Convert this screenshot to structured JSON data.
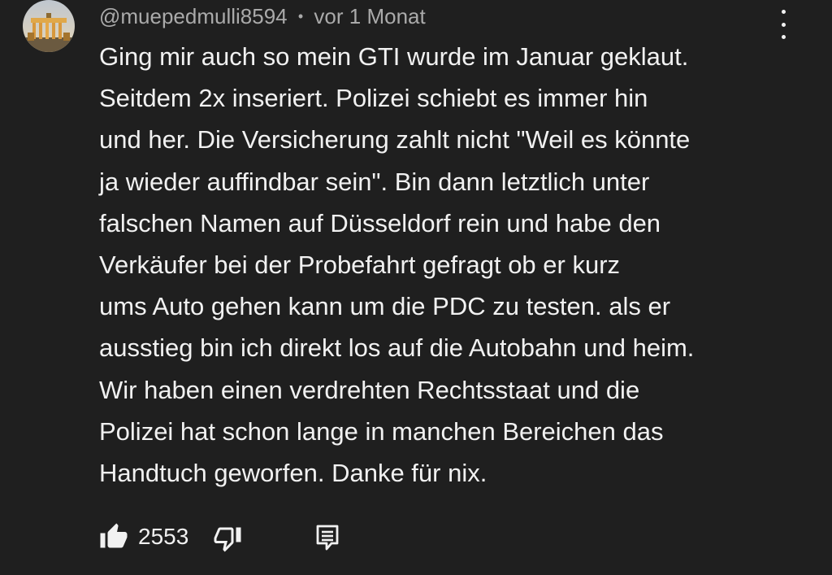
{
  "comment": {
    "author": "@muepedmulli8594",
    "separator": "•",
    "timestamp": "vor 1 Monat",
    "text_lines": [
      "Ging mir auch so mein GTI wurde im Januar geklaut.",
      "Seitdem 2x inseriert. Polizei schiebt es immer hin",
      "und her. Die Versicherung zahlt nicht \"Weil es könnte",
      "ja wieder auffindbar sein\". Bin dann letztlich unter",
      "falschen Namen auf Düsseldorf rein und habe den",
      "Verkäufer bei der Probefahrt gefragt ob er kurz",
      "ums Auto gehen kann um die PDC zu testen. als er",
      "ausstieg bin ich direkt los auf die Autobahn und heim.",
      "Wir haben einen verdrehten Rechtsstaat und die",
      "Polizei hat schon lange in manchen Bereichen das",
      "Handtuch geworfen. Danke für nix."
    ],
    "like_count": "2553"
  },
  "icons": {
    "avatar": "avatar-brandenburger-tor",
    "more": "more-vert-icon",
    "like": "thumbs-up-filled-icon",
    "dislike": "thumbs-down-outline-icon",
    "reply": "reply-comment-icon"
  },
  "colors": {
    "background": "#1f1f1f",
    "text_primary": "#f1f1f1",
    "text_secondary": "#aaaaaa"
  }
}
